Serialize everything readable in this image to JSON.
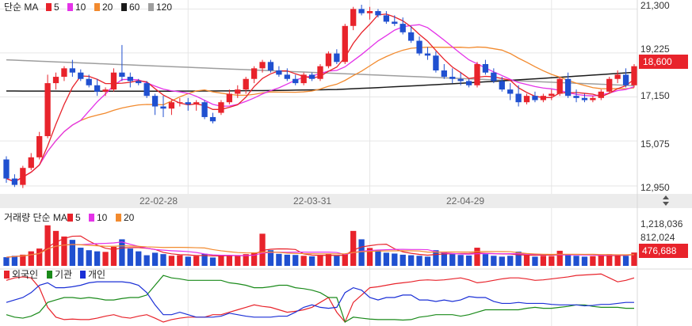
{
  "price_panel": {
    "legend_label": "단순 MA",
    "ma_periods": [
      "5",
      "10",
      "20",
      "60",
      "120"
    ],
    "ma_colors": [
      "#e8232b",
      "#e433e8",
      "#f28a2e",
      "#1a1a1a",
      "#9e9e9e"
    ],
    "y_ticks": [
      "21,300",
      "19,225",
      "17,150",
      "15,075",
      "12,950"
    ],
    "current_price": "18,600"
  },
  "volume_panel": {
    "legend_label": "거래량 단순 MA",
    "ma_periods": [
      "5",
      "10",
      "20"
    ],
    "ma_colors": [
      "#e8232b",
      "#e433e8",
      "#f28a2e"
    ],
    "y_ticks": [
      "1,218,036",
      "812,024"
    ],
    "current_volume": "476,688"
  },
  "investor_panel": {
    "legend": [
      "외국인",
      "기관",
      "개인"
    ],
    "colors": [
      "#e8232b",
      "#1a8a1a",
      "#1a2fd6"
    ]
  },
  "date_labels": [
    "22-02-28",
    "22-03-31",
    "22-04-29"
  ],
  "colors": {
    "up": "#e8232b",
    "down": "#2050d0",
    "grid": "#e6e6e6",
    "separator": "#d9d9d9"
  },
  "chart_data": {
    "type": "candlestick",
    "ylim": [
      12800,
      21500
    ],
    "date_ticks": [
      {
        "label": "22-02-28",
        "index": 22
      },
      {
        "label": "22-03-31",
        "index": 44
      },
      {
        "label": "22-04-29",
        "index": 66
      }
    ],
    "candles": [
      [
        14200,
        14350,
        13100,
        13300
      ],
      [
        13300,
        13500,
        12900,
        13000
      ],
      [
        13000,
        13900,
        12850,
        13800
      ],
      [
        13800,
        14500,
        13700,
        14300
      ],
      [
        14300,
        15500,
        14200,
        15300
      ],
      [
        15300,
        18200,
        15200,
        17800
      ],
      [
        17800,
        18300,
        17500,
        18100
      ],
      [
        18100,
        18600,
        17900,
        18500
      ],
      [
        18500,
        18900,
        18100,
        18300
      ],
      [
        18300,
        18450,
        17900,
        18000
      ],
      [
        18000,
        18200,
        17600,
        17700
      ],
      [
        17700,
        18000,
        17200,
        17400
      ],
      [
        17400,
        17600,
        17200,
        17500
      ],
      [
        17500,
        18500,
        17400,
        18300
      ],
      [
        18300,
        19600,
        17900,
        18100
      ],
      [
        18100,
        18300,
        17600,
        17900
      ],
      [
        17900,
        18000,
        17700,
        17800
      ],
      [
        17800,
        17900,
        17100,
        17200
      ],
      [
        17200,
        17300,
        16300,
        16700
      ],
      [
        16700,
        17200,
        16200,
        16600
      ],
      [
        16600,
        17000,
        16300,
        16900
      ],
      [
        16900,
        17100,
        16700,
        16900
      ],
      [
        16900,
        17100,
        16500,
        16800
      ],
      [
        16800,
        17000,
        16500,
        16900
      ],
      [
        16900,
        17000,
        16100,
        16200
      ],
      [
        16200,
        16400,
        15900,
        16000
      ],
      [
        16400,
        17000,
        16300,
        16900
      ],
      [
        16900,
        17500,
        16800,
        17300
      ],
      [
        17300,
        17700,
        17100,
        17500
      ],
      [
        17500,
        18100,
        17300,
        18000
      ],
      [
        18000,
        18600,
        17800,
        18500
      ],
      [
        18500,
        18900,
        18300,
        18800
      ],
      [
        18800,
        18900,
        18300,
        18400
      ],
      [
        18400,
        18600,
        18100,
        18200
      ],
      [
        18200,
        18500,
        17900,
        18000
      ],
      [
        18000,
        18200,
        17700,
        17800
      ],
      [
        17800,
        18300,
        17700,
        18200
      ],
      [
        18200,
        18300,
        17900,
        18000
      ],
      [
        18000,
        18700,
        17900,
        18600
      ],
      [
        18600,
        19300,
        18500,
        19200
      ],
      [
        19200,
        19400,
        18700,
        18800
      ],
      [
        18800,
        20600,
        18700,
        20500
      ],
      [
        20500,
        21400,
        20300,
        21300
      ],
      [
        21300,
        21500,
        21000,
        21100
      ],
      [
        21100,
        21400,
        20800,
        21200
      ],
      [
        21200,
        21300,
        20900,
        21000
      ],
      [
        21000,
        21200,
        20600,
        20700
      ],
      [
        20700,
        21000,
        20500,
        20600
      ],
      [
        20600,
        20900,
        20100,
        20200
      ],
      [
        20200,
        20500,
        19700,
        19800
      ],
      [
        19800,
        20000,
        19100,
        19200
      ],
      [
        19200,
        19500,
        18900,
        19100
      ],
      [
        19100,
        19300,
        18300,
        18400
      ],
      [
        18400,
        18700,
        18000,
        18100
      ],
      [
        18100,
        18500,
        17800,
        18000
      ],
      [
        18000,
        18300,
        17700,
        17900
      ],
      [
        17900,
        18000,
        17600,
        17700
      ],
      [
        17700,
        18800,
        17600,
        18700
      ],
      [
        18700,
        18900,
        18200,
        18300
      ],
      [
        18300,
        18500,
        17800,
        17900
      ],
      [
        17900,
        18100,
        17400,
        17500
      ],
      [
        17500,
        17800,
        17000,
        17300
      ],
      [
        17300,
        17700,
        16700,
        16900
      ],
      [
        16900,
        17300,
        16800,
        17200
      ],
      [
        17200,
        17400,
        16900,
        17000
      ],
      [
        17000,
        17300,
        16900,
        17200
      ],
      [
        17200,
        17500,
        17000,
        17300
      ],
      [
        17300,
        18100,
        17200,
        18000
      ],
      [
        18000,
        18300,
        17100,
        17200
      ],
      [
        17200,
        17500,
        16900,
        17100
      ],
      [
        17100,
        17300,
        16900,
        17000
      ],
      [
        17000,
        17200,
        16900,
        17100
      ],
      [
        17100,
        17500,
        17000,
        17400
      ],
      [
        17400,
        18100,
        17300,
        18000
      ],
      [
        18000,
        18400,
        17800,
        18200
      ],
      [
        18200,
        18500,
        17600,
        17700
      ],
      [
        17700,
        18700,
        17600,
        18600
      ]
    ],
    "volume": [
      310000,
      360000,
      400000,
      520000,
      620000,
      1450000,
      1250000,
      1050000,
      930000,
      650000,
      560000,
      520000,
      500000,
      680000,
      950000,
      620000,
      520000,
      380000,
      470000,
      420000,
      360000,
      380000,
      330000,
      350000,
      430000,
      300000,
      380000,
      370000,
      360000,
      420000,
      480000,
      1150000,
      560000,
      430000,
      400000,
      390000,
      360000,
      340000,
      380000,
      420000,
      360000,
      410000,
      1250000,
      950000,
      640000,
      560000,
      470000,
      440000,
      400000,
      380000,
      360000,
      330000,
      560000,
      500000,
      420000,
      390000,
      370000,
      650000,
      420000,
      360000,
      330000,
      360000,
      510000,
      380000,
      330000,
      360000,
      350000,
      540000,
      400000,
      360000,
      330000,
      350000,
      380000,
      420000,
      380000,
      360000,
      476688
    ],
    "investor_flow": {
      "foreign": [
        0.85,
        0.9,
        0.92,
        0.9,
        0.7,
        0.3,
        0.1,
        0.05,
        0.06,
        0.05,
        0.05,
        0.08,
        0.12,
        0.15,
        0.1,
        0.08,
        0.12,
        0.15,
        0.08,
        0.0,
        0.05,
        0.08,
        0.1,
        0.1,
        0.1,
        0.15,
        0.15,
        0.2,
        0.25,
        0.3,
        0.35,
        0.32,
        0.3,
        0.25,
        0.2,
        0.22,
        0.25,
        0.3,
        0.4,
        0.5,
        0.2,
        0.0,
        0.4,
        0.55,
        0.7,
        0.72,
        0.75,
        0.78,
        0.8,
        0.82,
        0.85,
        0.86,
        0.85,
        0.86,
        0.88,
        0.9,
        0.86,
        0.8,
        0.82,
        0.85,
        0.88,
        0.9,
        0.9,
        0.88,
        0.85,
        0.86,
        0.88,
        0.9,
        0.92,
        0.95,
        0.96,
        0.97,
        0.98,
        0.9,
        0.82,
        0.85,
        0.9
      ],
      "institution": [
        0.15,
        0.1,
        0.08,
        0.12,
        0.2,
        0.4,
        0.45,
        0.5,
        0.5,
        0.48,
        0.5,
        0.48,
        0.45,
        0.45,
        0.48,
        0.5,
        0.5,
        0.55,
        0.75,
        0.95,
        0.9,
        0.88,
        0.85,
        0.85,
        0.85,
        0.85,
        0.85,
        0.8,
        0.78,
        0.75,
        0.7,
        0.7,
        0.72,
        0.75,
        0.75,
        0.7,
        0.68,
        0.65,
        0.6,
        0.5,
        0.5,
        0.0,
        0.1,
        0.08,
        0.06,
        0.05,
        0.05,
        0.05,
        0.04,
        0.05,
        0.1,
        0.12,
        0.15,
        0.15,
        0.15,
        0.12,
        0.15,
        0.2,
        0.25,
        0.25,
        0.25,
        0.25,
        0.25,
        0.28,
        0.3,
        0.28,
        0.28,
        0.3,
        0.32,
        0.35,
        0.35,
        0.32,
        0.3,
        0.3,
        0.3,
        0.28,
        0.28
      ],
      "individual": [
        0.4,
        0.45,
        0.5,
        0.6,
        0.75,
        0.8,
        0.7,
        0.7,
        0.72,
        0.75,
        0.8,
        0.82,
        0.82,
        0.82,
        0.82,
        0.8,
        0.75,
        0.6,
        0.35,
        0.15,
        0.15,
        0.2,
        0.15,
        0.1,
        0.1,
        0.1,
        0.12,
        0.18,
        0.15,
        0.12,
        0.1,
        0.1,
        0.1,
        0.12,
        0.12,
        0.2,
        0.3,
        0.35,
        0.3,
        0.28,
        0.3,
        0.6,
        0.7,
        0.65,
        0.5,
        0.45,
        0.5,
        0.5,
        0.55,
        0.55,
        0.45,
        0.45,
        0.42,
        0.45,
        0.42,
        0.45,
        0.52,
        0.5,
        0.5,
        0.42,
        0.38,
        0.38,
        0.4,
        0.38,
        0.38,
        0.38,
        0.36,
        0.35,
        0.35,
        0.35,
        0.33,
        0.34,
        0.36,
        0.36,
        0.38,
        0.4,
        0.4
      ]
    }
  }
}
